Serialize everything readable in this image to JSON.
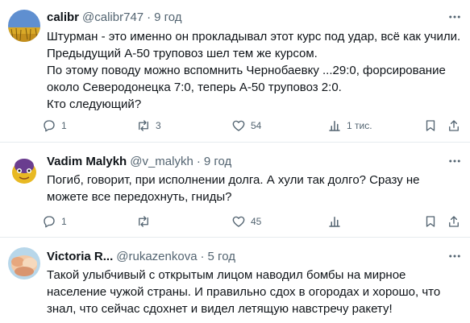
{
  "posts": [
    {
      "author": "calibr",
      "handle": "@calibr747",
      "time": "9 год",
      "lines": [
        "Штурман - это именно он прокладывал этот курс под удар, всё как учили.",
        "Предыдущий А-50 труповоз шел тем же курсом.",
        "По этому поводу можно вспомнить Чернобаевку ...29:0, форсирование",
        "около Северодонецка 7:0, теперь А-50 труповоз 2:0.",
        "Кто следующий?"
      ],
      "replies": "1",
      "reposts": "3",
      "likes": "54",
      "views": "1 тис."
    },
    {
      "author": "Vadim Malykh",
      "handle": "@v_malykh",
      "time": "9 год",
      "lines": [
        "Погиб, говорит, при исполнении долга. А хули так долго? Сразу не",
        "можете все передохнуть, гниды?"
      ],
      "replies": "1",
      "reposts": "",
      "likes": "45",
      "views": ""
    },
    {
      "author": "Victoria R...",
      "handle": "@rukazenkova",
      "time": "5 год",
      "lines": [
        "Такой улыбчивый с открытым лицом наводил бомбы на мирное",
        "население чужой страны. И правильно сдох в огородах и хорошо, что",
        "знал, что сейчас сдохнет и видел летящую навстречу ракету!"
      ]
    }
  ],
  "separator": "·",
  "icons": {
    "reply": "reply-icon",
    "repost": "repost-icon",
    "like": "like-icon",
    "views": "views-icon",
    "bookmark": "bookmark-icon",
    "share": "share-icon",
    "more": "more-icon"
  },
  "colors": {
    "text": "#0f1419",
    "secondary": "#536471",
    "divider": "#e6ebef"
  }
}
